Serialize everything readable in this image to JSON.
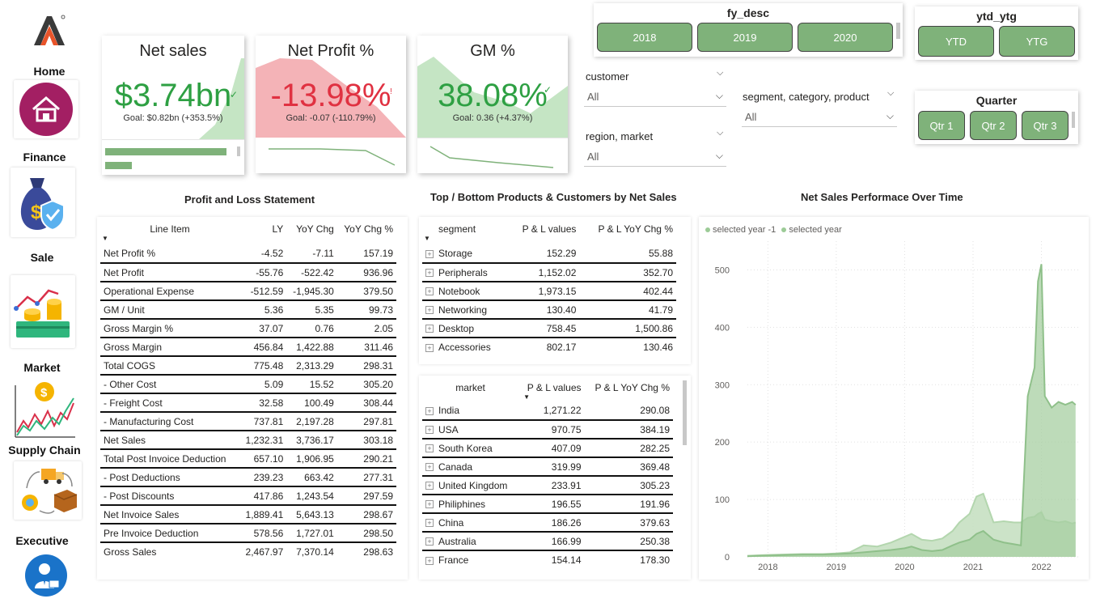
{
  "sidebar": {
    "items": [
      {
        "label": "Home",
        "icon": "house-icon"
      },
      {
        "label": "Finance",
        "icon": "money-bag-icon"
      },
      {
        "label": "Sale",
        "icon": "coins-chart-icon"
      },
      {
        "label": "Market",
        "icon": "market-trend-icon"
      },
      {
        "label": "Supply Chain",
        "icon": "supply-chain-icon"
      },
      {
        "label": "Executive",
        "icon": "executive-icon"
      }
    ]
  },
  "kpis": {
    "net_sales": {
      "title": "Net sales",
      "value": "$3.74bn",
      "goal": "Goal: $0.82bn (+353.5%)"
    },
    "net_profit": {
      "title": "Net Profit %",
      "value": "-13.98%",
      "goal": "Goal: -0.07 (-110.79%)"
    },
    "gm": {
      "title": "GM %",
      "value": "38.08%",
      "goal": "Goal: 0.36 (+4.37%)"
    }
  },
  "slicers": {
    "fy_desc": {
      "title": "fy_desc",
      "options": [
        "2018",
        "2019",
        "2020"
      ]
    },
    "ytd_ytg": {
      "title": "ytd_ytg",
      "options": [
        "YTD",
        "YTG"
      ]
    },
    "quarter": {
      "title": "Quarter",
      "options": [
        "Qtr 1",
        "Qtr 2",
        "Qtr 3"
      ]
    },
    "customer": {
      "label": "customer",
      "value": "All"
    },
    "region_market": {
      "label": "region, market",
      "value": "All"
    },
    "segment_category_product": {
      "label": "segment, category, product",
      "value": "All"
    }
  },
  "pl_statement": {
    "title": "Profit and Loss Statement",
    "headers": [
      "Line Item",
      "LY",
      "YoY Chg",
      "YoY Chg %"
    ],
    "rows": [
      [
        "Net Profit %",
        "-4.52",
        "-7.11",
        "157.19"
      ],
      [
        "Net Profit",
        "-55.76",
        "-522.42",
        "936.96"
      ],
      [
        "Operational Expense",
        "-512.59",
        "-1,945.30",
        "379.50"
      ],
      [
        "GM / Unit",
        "5.36",
        "5.35",
        "99.73"
      ],
      [
        "Gross Margin %",
        "37.07",
        "0.76",
        "2.05"
      ],
      [
        "Gross Margin",
        "456.84",
        "1,422.88",
        "311.46"
      ],
      [
        "Total COGS",
        "775.48",
        "2,313.29",
        "298.31"
      ],
      [
        "- Other Cost",
        "5.09",
        "15.52",
        "305.20"
      ],
      [
        "- Freight Cost",
        "32.58",
        "100.49",
        "308.44"
      ],
      [
        "- Manufacturing Cost",
        "737.81",
        "2,197.28",
        "297.81"
      ],
      [
        "Net Sales",
        "1,232.31",
        "3,736.17",
        "303.18"
      ],
      [
        "Total Post Invoice Deduction",
        "657.10",
        "1,906.95",
        "290.21"
      ],
      [
        "- Post Deductions",
        "239.23",
        "663.42",
        "277.31"
      ],
      [
        "- Post Discounts",
        "417.86",
        "1,243.54",
        "297.59"
      ],
      [
        "Net Invoice Sales",
        "1,889.41",
        "5,643.13",
        "298.67"
      ],
      [
        "Pre Invoice Deduction",
        "578.56",
        "1,727.01",
        "298.50"
      ],
      [
        "Gross Sales",
        "2,467.97",
        "7,370.14",
        "298.63"
      ]
    ]
  },
  "top_bottom": {
    "title": "Top / Bottom Products & Customers by Net Sales",
    "segment_table": {
      "headers": [
        "segment",
        "P & L values",
        "P & L YoY Chg %"
      ],
      "rows": [
        [
          "Storage",
          "152.29",
          "55.88"
        ],
        [
          "Peripherals",
          "1,152.02",
          "352.70"
        ],
        [
          "Notebook",
          "1,973.15",
          "402.44"
        ],
        [
          "Networking",
          "130.40",
          "41.79"
        ],
        [
          "Desktop",
          "758.45",
          "1,500.86"
        ],
        [
          "Accessories",
          "802.17",
          "130.46"
        ]
      ]
    },
    "market_table": {
      "headers": [
        "market",
        "P & L values",
        "P & L YoY Chg %"
      ],
      "rows": [
        [
          "India",
          "1,271.22",
          "290.08"
        ],
        [
          "USA",
          "970.75",
          "384.19"
        ],
        [
          "South Korea",
          "407.09",
          "282.25"
        ],
        [
          "Canada",
          "319.99",
          "369.48"
        ],
        [
          "United Kingdom",
          "233.91",
          "305.23"
        ],
        [
          "Philiphines",
          "196.55",
          "191.96"
        ],
        [
          "China",
          "186.26",
          "379.63"
        ],
        [
          "Australia",
          "166.99",
          "250.38"
        ],
        [
          "France",
          "154.14",
          "178.30"
        ]
      ]
    }
  },
  "colors": {
    "accent_green": "#7fb27a",
    "positive": "#2ea043",
    "negative": "#e03141",
    "area_light": "#c5dfc2",
    "area_dark": "#a6cda1"
  },
  "chart_data": {
    "type": "area",
    "title": "Net Sales Performace Over Time",
    "legend_position": "top-left",
    "ylim": [
      0,
      550
    ],
    "yticks": [
      0,
      100,
      200,
      300,
      400,
      500
    ],
    "xticks": [
      "2018",
      "2019",
      "2020",
      "2021",
      "2022"
    ],
    "x": [
      2017.7,
      2017.9,
      2018.2,
      2018.5,
      2018.8,
      2019.0,
      2019.2,
      2019.4,
      2019.6,
      2019.8,
      2020.0,
      2020.1,
      2020.25,
      2020.4,
      2020.55,
      2020.7,
      2020.8,
      2020.95,
      2021.05,
      2021.15,
      2021.3,
      2021.45,
      2021.6,
      2021.7,
      2021.8,
      2021.9,
      2021.95,
      2022.0,
      2022.05,
      2022.15,
      2022.25,
      2022.35,
      2022.45,
      2022.5
    ],
    "series": [
      {
        "name": "selected year -1",
        "values": [
          2,
          3,
          4,
          5,
          5,
          6,
          8,
          20,
          18,
          25,
          35,
          40,
          30,
          28,
          32,
          45,
          60,
          75,
          105,
          110,
          60,
          62,
          60,
          60,
          68,
          70,
          75,
          78,
          65,
          62,
          60,
          62,
          58,
          60
        ]
      },
      {
        "name": "selected year",
        "values": [
          1,
          2,
          3,
          4,
          4,
          5,
          6,
          8,
          10,
          12,
          15,
          18,
          12,
          10,
          12,
          20,
          25,
          30,
          40,
          45,
          30,
          25,
          22,
          20,
          280,
          330,
          480,
          510,
          280,
          260,
          270,
          265,
          270,
          265
        ]
      }
    ]
  }
}
